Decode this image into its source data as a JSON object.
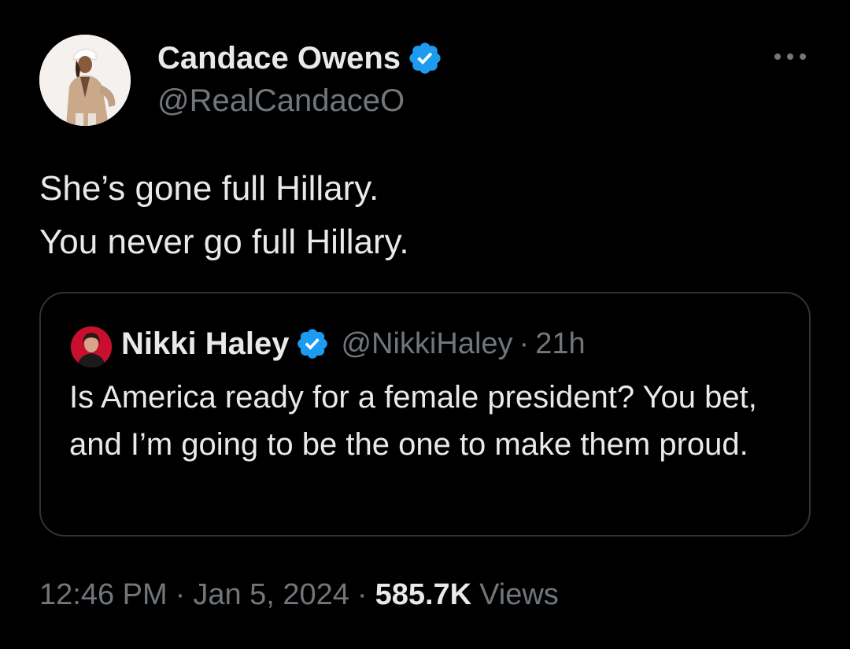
{
  "tweet": {
    "author": {
      "name": "Candace Owens",
      "handle": "@RealCandaceO",
      "verified": true
    },
    "text_lines": [
      "She’s gone full Hillary.",
      "You never go full Hillary."
    ],
    "quoted_tweet": {
      "author_name": "Nikki Haley",
      "author_handle": "@NikkiHaley",
      "separator": "·",
      "age": "21h",
      "verified": true,
      "text": "Is America ready for a female president? You bet, and I’m going to be the one to make them proud."
    },
    "meta": {
      "time": "12:46 PM",
      "separator": "·",
      "date": "Jan 5, 2024",
      "views_count": "585.7K",
      "views_label": "Views"
    }
  },
  "icons": {
    "verified": "verified-badge-icon",
    "more": "more-options-icon"
  },
  "colors": {
    "background": "#000000",
    "primary_text": "#e7e9ea",
    "secondary_text": "#71767b",
    "verified_blue": "#1d9bf0",
    "border": "#2f3336"
  }
}
